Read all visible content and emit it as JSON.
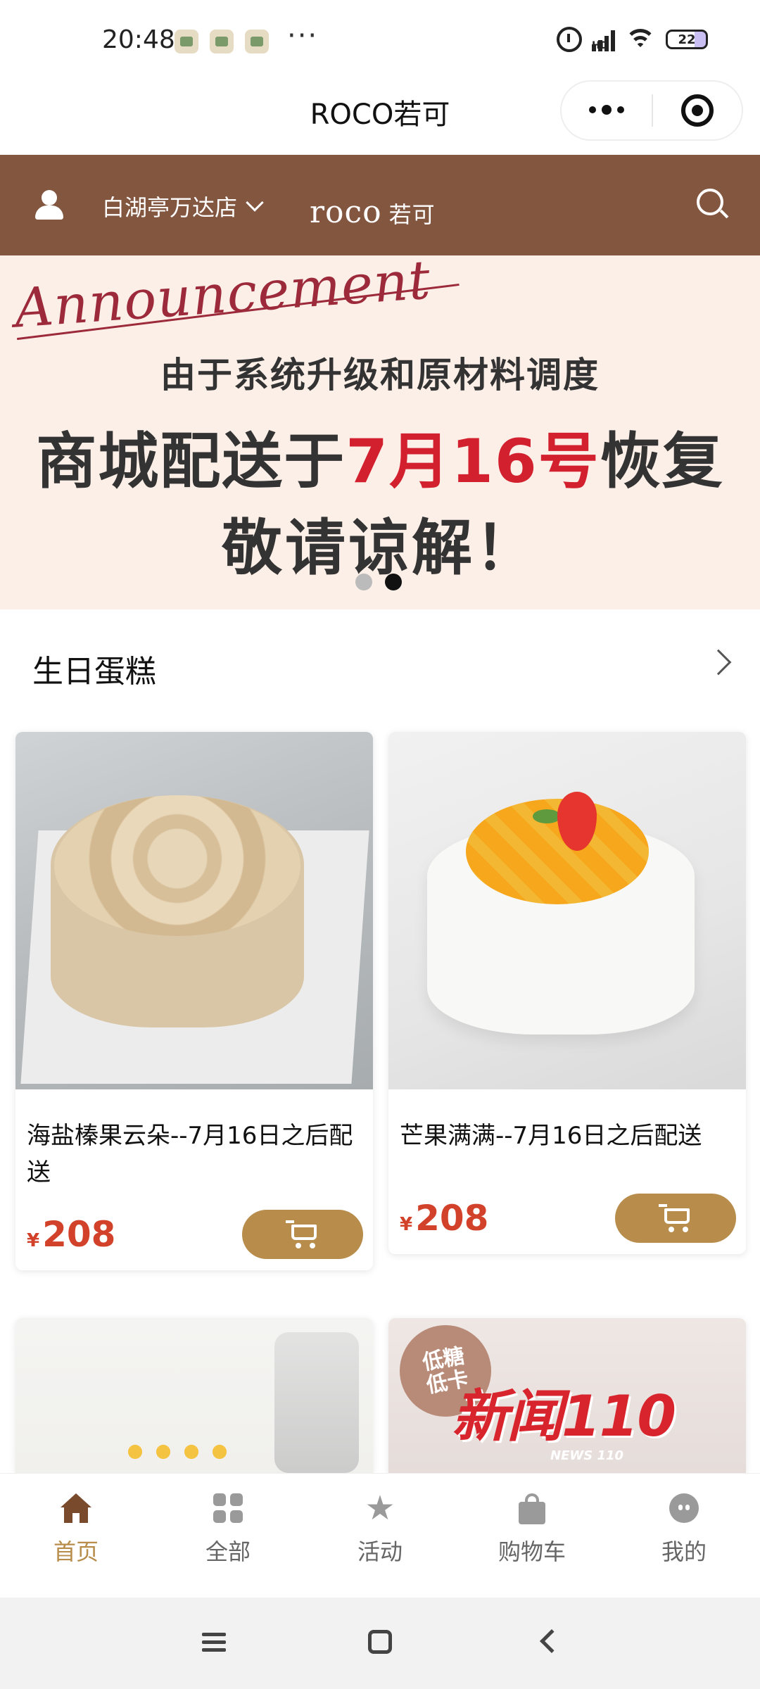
{
  "status_bar": {
    "time": "20:48",
    "more": "···",
    "network": "HD",
    "battery": "22"
  },
  "mp_header": {
    "title": "ROCO若可"
  },
  "brand_bar": {
    "store": "白湖亭万达店",
    "logo_text": "roco",
    "logo_cn": "若可"
  },
  "banner": {
    "script_text": "Announcement",
    "line1": "由于系统升级和原材料调度",
    "line2_prefix": "商城配送于",
    "line2_highlight": "7月16号",
    "line2_suffix": "恢复",
    "line3": "敬请谅解！",
    "slide_count": 2,
    "active_slide": 2
  },
  "section": {
    "title": "生日蛋糕"
  },
  "products": [
    {
      "name": "海盐榛果云朵--7月16日之后配送",
      "currency": "¥",
      "price": "208"
    },
    {
      "name": "芒果满满--7月16日之后配送",
      "currency": "¥",
      "price": "208"
    }
  ],
  "product_image_texts": {
    "badge_line1": "低糖",
    "badge_line2": "低卡",
    "news_text": "新闻110",
    "news_sub": "NEWS 110"
  },
  "tabs": [
    {
      "label": "首页",
      "icon": "home-icon",
      "active": true
    },
    {
      "label": "全部",
      "icon": "grid-icon",
      "active": false
    },
    {
      "label": "活动",
      "icon": "star-icon",
      "active": false
    },
    {
      "label": "购物车",
      "icon": "bag-icon",
      "active": false
    },
    {
      "label": "我的",
      "icon": "me-icon",
      "active": false
    }
  ],
  "colors": {
    "brand_brown": "#835640",
    "accent_gold": "#b88c4a",
    "price_red": "#d2422a",
    "banner_bg": "#fcefe8",
    "highlight_red": "#d3202e"
  }
}
